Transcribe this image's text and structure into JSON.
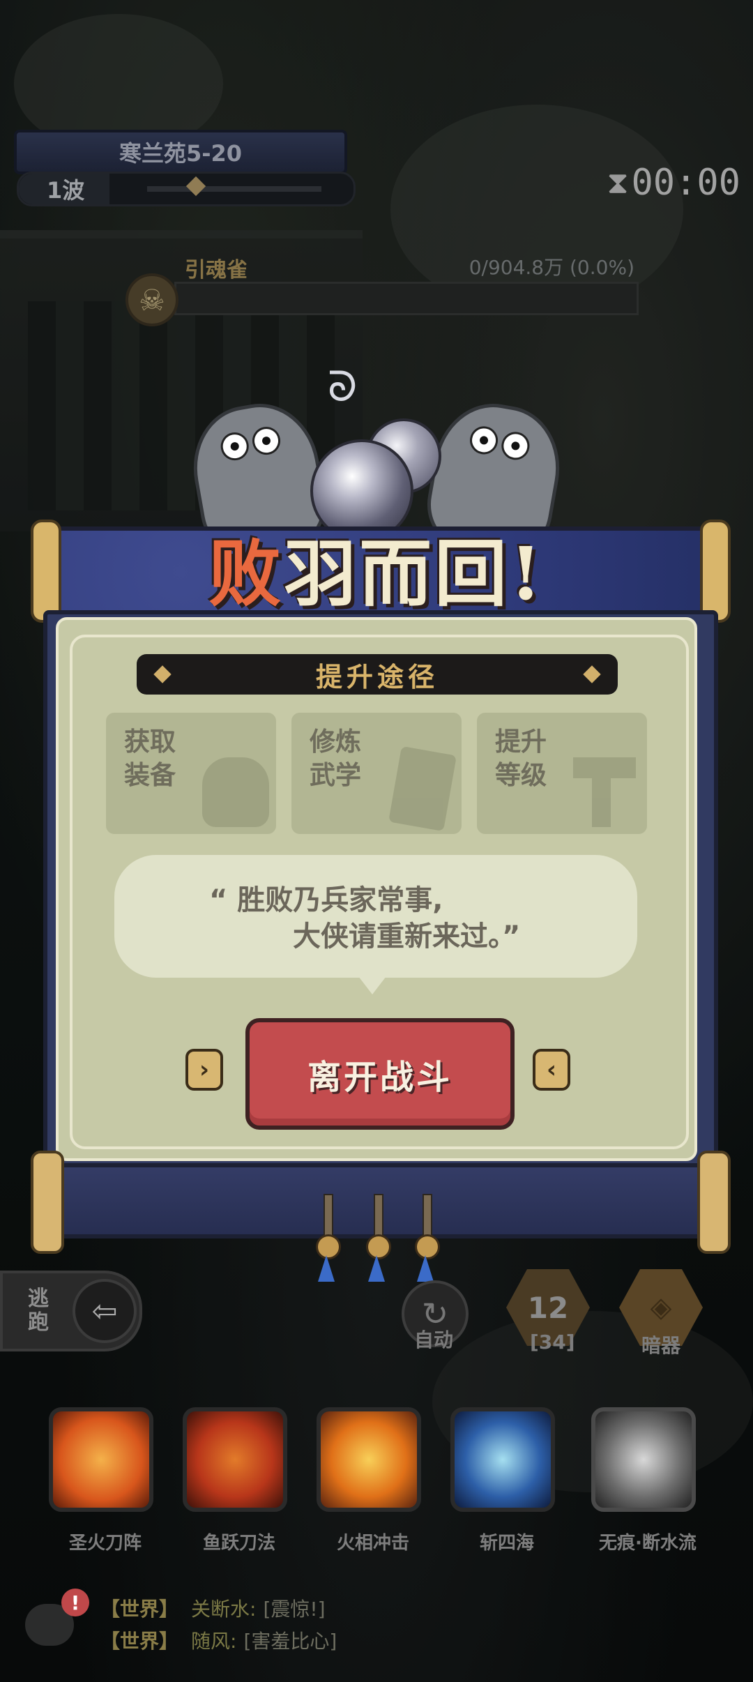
{
  "hud": {
    "stage": "寒兰苑5-20",
    "wave": "1波",
    "timer": "00:00",
    "boss_name": "引魂雀",
    "boss_hp": "0/904.8万 (0.0%)"
  },
  "dialog": {
    "title_first": "败",
    "title_rest": "羽而回!",
    "section_title": "提升途径",
    "cards": [
      {
        "label": "获取\n装备",
        "icon": "armor-icon"
      },
      {
        "label": "修炼\n武学",
        "icon": "manual-icon"
      },
      {
        "label": "提升\n等级",
        "icon": "level-up-icon"
      }
    ],
    "quote_line1": "“ 胜败乃兵家常事,",
    "quote_line2": "大侠请重新来过。”",
    "leave_button": "离开战斗"
  },
  "controls": {
    "flee": "逃跑",
    "auto": "自动",
    "count": "12",
    "count_sub": "[34]",
    "hidden_weapon": "暗器"
  },
  "skills": [
    {
      "name": "圣火刀阵",
      "color": "#d8561c"
    },
    {
      "name": "鱼跃刀法",
      "color": "#b8361a"
    },
    {
      "name": "火相冲击",
      "color": "#e07018"
    },
    {
      "name": "斩四海",
      "color": "#2d5fa8"
    },
    {
      "name": "无痕·断水流",
      "color": "#6d6d6d"
    }
  ],
  "chat": {
    "badge": "!",
    "messages": [
      {
        "channel": "【世界】",
        "user": "关断水:",
        "text": "[震惊!]"
      },
      {
        "channel": "【世界】",
        "user": "随风:",
        "text": "[害羞比心]"
      }
    ]
  }
}
